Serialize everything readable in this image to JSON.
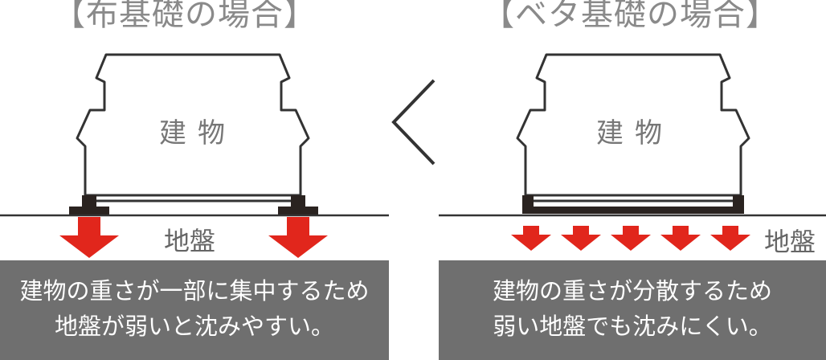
{
  "left_panel": {
    "title": "【布基礎の場合】",
    "building_label": "建物",
    "ground_label": "地盤",
    "caption_line1": "建物の重さが一部に集中するため",
    "caption_line2": "地盤が弱いと沈みやすい。"
  },
  "right_panel": {
    "title": "【ベタ基礎の場合】",
    "building_label": "建物",
    "ground_label": "地盤",
    "caption_line1": "建物の重さが分散するため",
    "caption_line2": "弱い地盤でも沈みにくい。"
  },
  "comparison_symbol": "<",
  "colors": {
    "arrow": "#e1261c",
    "caption_box": "#6f6f6f",
    "outline": "#333333",
    "foundation": "#2a2320"
  }
}
